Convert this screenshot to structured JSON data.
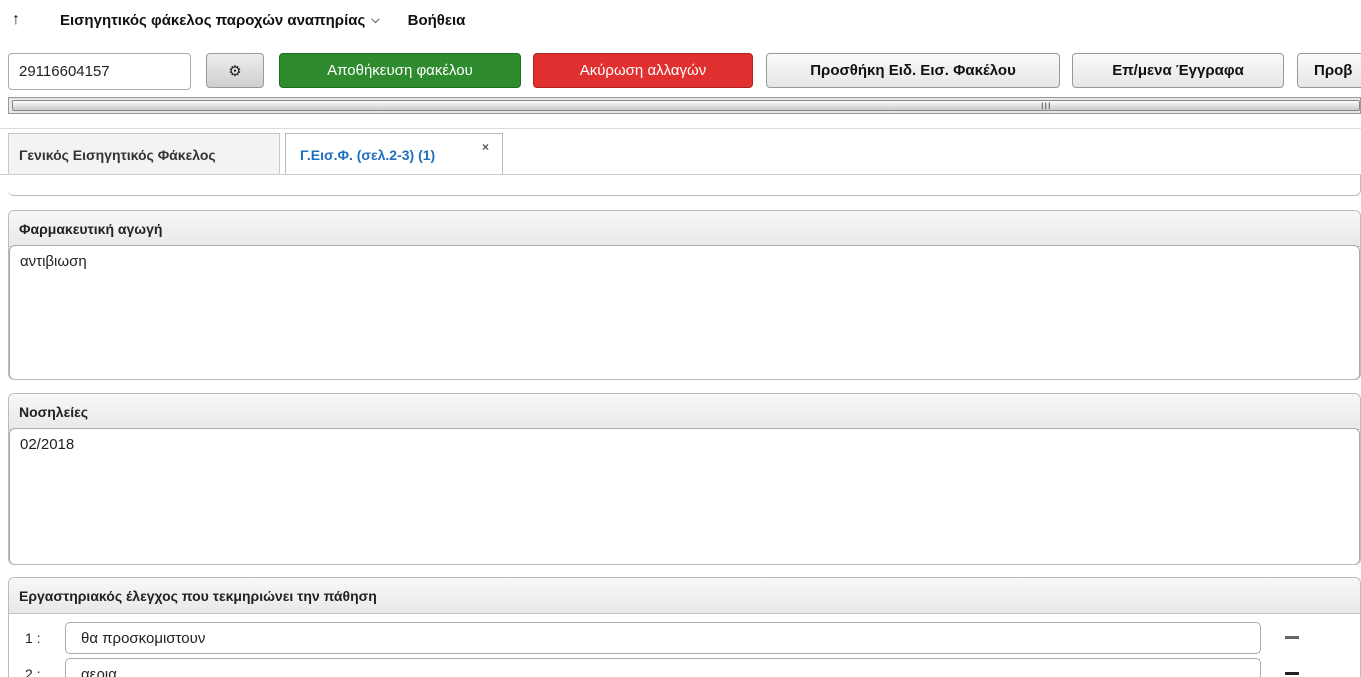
{
  "menubar": {
    "up_icon": "arrow-up-icon",
    "title": "Εισηγητικός φάκελος παροχών αναπηρίας",
    "help": "Βοήθεια"
  },
  "toolbar": {
    "id_value": "29116604157",
    "gear_icon": "gear-icon",
    "save_label": "Αποθήκευση φακέλου",
    "cancel_label": "Ακύρωση αλλαγών",
    "add_label": "Προσθήκη Ειδ. Εισ. Φακέλου",
    "docs_label": "Επ/μενα Έγγραφα",
    "more_label": "Προβ"
  },
  "scrollbar": {
    "grip": "III"
  },
  "tabs": [
    {
      "label": "Γενικός Εισηγητικός Φάκελος"
    },
    {
      "label": "Γ.Εισ.Φ. (σελ.2-3) (1)",
      "close": "×"
    }
  ],
  "colors": {
    "save": "#2e8b2e",
    "cancel": "#e03030",
    "active_tab": "#1e6fbf"
  },
  "sections": {
    "medication": {
      "title": "Φαρμακευτική αγωγή",
      "value": "αντιβιωση"
    },
    "hospitalizations": {
      "title": "Νοσηλείες",
      "value": "02/2018"
    },
    "lab_tests": {
      "title": "Εργαστηριακός έλεγχος που τεκμηριώνει την πάθηση",
      "items": [
        {
          "num": "1 :",
          "value": "θα προσκομιστουν"
        },
        {
          "num": "2 :",
          "value": "αερια"
        }
      ]
    }
  }
}
